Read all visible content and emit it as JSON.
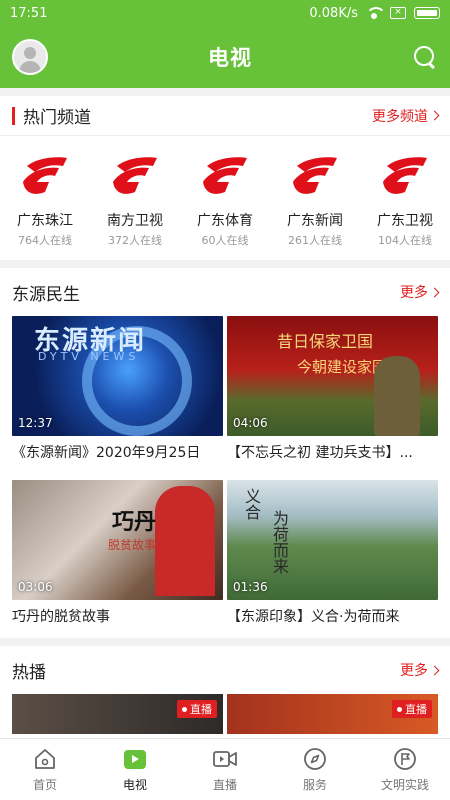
{
  "status": {
    "time": "17:51",
    "speed": "0.08K/s"
  },
  "header": {
    "title": "电视"
  },
  "hot_channels": {
    "title": "热门频道",
    "more": "更多频道",
    "items": [
      {
        "name": "广东珠江",
        "online": "764人在线"
      },
      {
        "name": "南方卫视",
        "online": "372人在线"
      },
      {
        "name": "广东体育",
        "online": "60人在线"
      },
      {
        "name": "广东新闻",
        "online": "261人在线"
      },
      {
        "name": "广东卫视",
        "online": "104人在线"
      }
    ]
  },
  "dongyuan": {
    "title": "东源民生",
    "more": "更多",
    "videos": [
      {
        "title": "《东源新闻》2020年9月25日",
        "duration": "12:37",
        "wm": "东源新闻",
        "wm2": "DYTV NEWS"
      },
      {
        "title": "【不忘兵之初 建功兵支书】...",
        "duration": "04:06",
        "t1": "昔日保家卫国",
        "t2": "今朝建设家园"
      },
      {
        "title": "巧丹的脱贫故事",
        "duration": "03:06",
        "t": "巧丹",
        "t2": "脱贫故事"
      },
      {
        "title": "【东源印象】义合·为荷而来",
        "duration": "01:36",
        "t": "义合",
        "t2": "为荷而来"
      }
    ]
  },
  "hot_play": {
    "title": "热播",
    "more": "更多",
    "badge": "直播"
  },
  "tabs": [
    {
      "label": "首页"
    },
    {
      "label": "电视"
    },
    {
      "label": "直播"
    },
    {
      "label": "服务"
    },
    {
      "label": "文明实践"
    }
  ],
  "colors": {
    "primary": "#67c23a",
    "accent": "#e02020"
  }
}
